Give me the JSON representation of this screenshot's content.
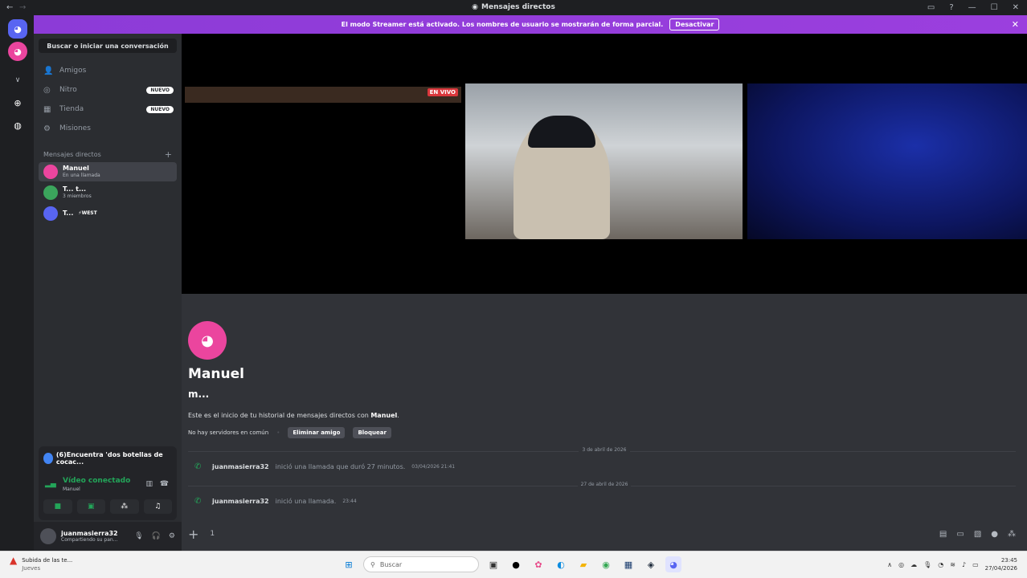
{
  "window": {
    "title": "Mensajes directos"
  },
  "banner": {
    "text": "El modo Streamer está activado. Los nombres de usuario se mostrarán de forma parcial.",
    "button": "Desactivar"
  },
  "sidebar": {
    "search_placeholder": "Buscar o iniciar una conversación",
    "nav": [
      {
        "label": "Amigos",
        "icon": "friends-icon"
      },
      {
        "label": "Nitro",
        "icon": "nitro-icon",
        "badge": "NUEVO"
      },
      {
        "label": "Tienda",
        "icon": "shop-icon",
        "badge": "NUEVO"
      },
      {
        "label": "Misiones",
        "icon": "quests-icon"
      }
    ],
    "dm_header": "Mensajes directos",
    "dms": [
      {
        "name": "Manuel",
        "status": "En una llamada"
      },
      {
        "name": "T... t...",
        "status": "3 miembros"
      },
      {
        "name": "T...",
        "status": "⚡WEST"
      }
    ]
  },
  "voice_panel": {
    "activity": "(6)Encuentra 'dos botellas de cocac...",
    "connected": "Vídeo conectado",
    "channel": "Manuel"
  },
  "user_panel": {
    "username": "juanmasierra32",
    "status": "Compartiendo su pan..."
  },
  "stream": {
    "live_label": "EN VIVO"
  },
  "chat": {
    "name": "Manuel",
    "nickname": "m...",
    "intro_prefix": "Este es el inicio de tu historial de mensajes directos con ",
    "intro_name": "Manuel",
    "intro_suffix": ".",
    "no_servers": "No hay servidores en común",
    "remove_friend": "Eliminar amigo",
    "block": "Bloquear",
    "messages": [
      {
        "date": "3 de abril de 2026",
        "user": "juanmasierra32",
        "text": "inició una llamada que duró 27 minutos.",
        "time": "03/04/2026 21:41"
      },
      {
        "date": "27 de abril de 2026",
        "user": "juanmasierra32",
        "text": "inició una llamada.",
        "time": "23:44"
      }
    ],
    "composer_value": "1"
  },
  "taskbar": {
    "notification_title": "Subida de las te...",
    "notification_sub": "Jueves",
    "search_placeholder": "Buscar",
    "clock_time": "23:45",
    "clock_date": "27/04/2026"
  },
  "colors": {
    "accent": "#5865f2",
    "banner": "#9b3fde",
    "online": "#23a559",
    "avatar": "#eb459e"
  }
}
